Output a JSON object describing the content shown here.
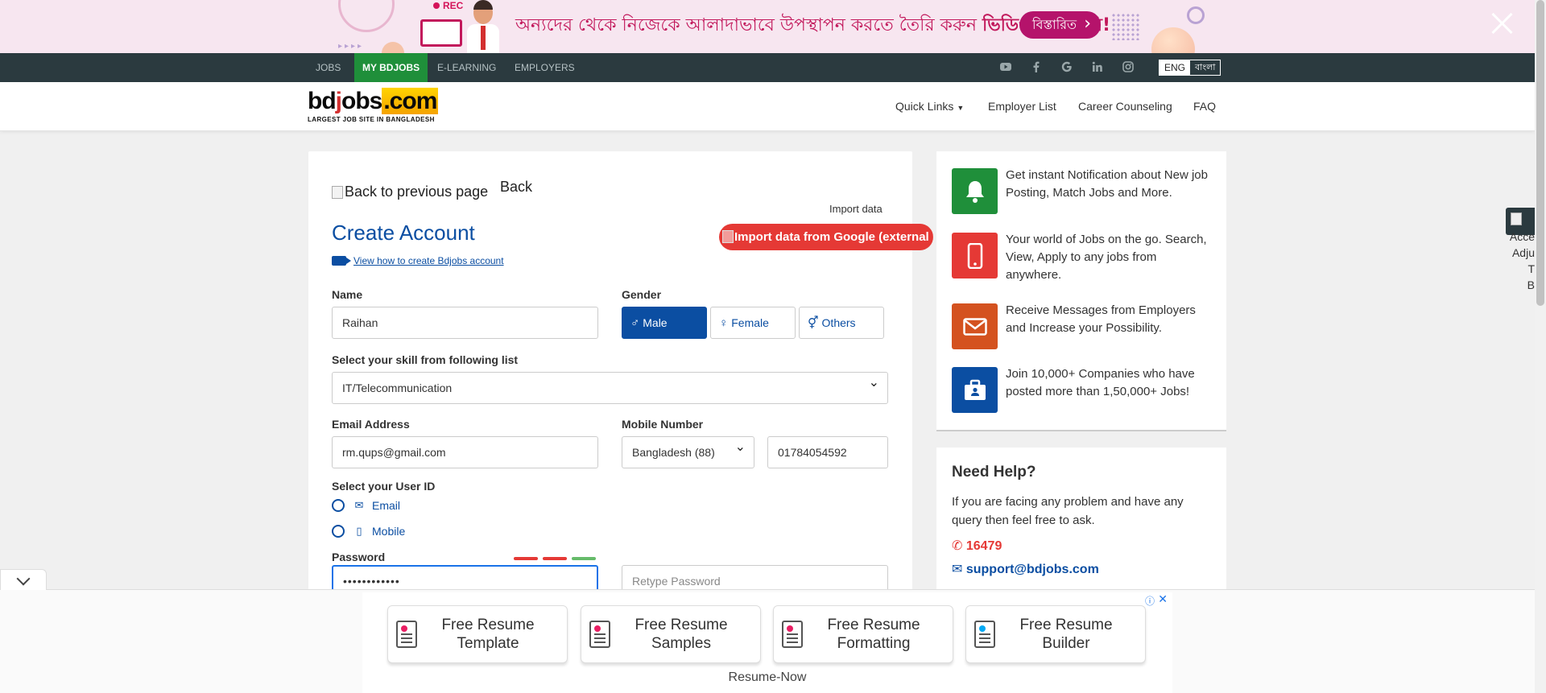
{
  "promo": {
    "rec": "REC",
    "headline_part1": "অন্যদের থেকে নিজেকে আলাদাভাবে উপস্থাপন করতে তৈরি করুন ",
    "headline_part2": "ভিডিও রিজিউমি!",
    "more": "বিস্তারিত"
  },
  "topnav": {
    "items": [
      "JOBS",
      "MY BDJOBS",
      "E-LEARNING",
      "EMPLOYERS"
    ],
    "active": "MY BDJOBS",
    "lang_eng": "ENG",
    "lang_bn": "বাংলা"
  },
  "header": {
    "logo_text": "bdjobs.com",
    "logo_tagline": "LARGEST JOB SITE IN BANGLADESH",
    "nav": [
      "Quick Links",
      "Employer List",
      "Career Counseling",
      "FAQ"
    ]
  },
  "form": {
    "back_img_alt": "Back to previous page",
    "back": "Back",
    "import_label": "Import data",
    "import_btn": "Import data from Google (external lin",
    "title": "Create Account",
    "howto_link": "View how to create Bdjobs account",
    "name_label": "Name",
    "name_value": "Raihan",
    "gender_label": "Gender",
    "gender": {
      "male": "Male",
      "female": "Female",
      "others": "Others",
      "selected": "Male"
    },
    "skill_label": "Select your skill from following list",
    "skill_value": "IT/Telecommunication",
    "email_label": "Email Address",
    "email_value": "rm.qups@gmail.com",
    "mobile_label": "Mobile Number",
    "country_value": "Bangladesh (88)",
    "mobile_value": "01784054592",
    "userid_label": "Select your User ID",
    "userid_email": "Email",
    "userid_mobile": "Mobile",
    "password_label": "Password",
    "password_value": "••••••••••••",
    "retype_placeholder": "Retype Password",
    "strength_colors": [
      "#e53935",
      "#e53935",
      "#66bb6a"
    ]
  },
  "features": [
    {
      "text": "Get instant Notification about New job Posting, Match Jobs and More.",
      "color": "#1f8f3a",
      "icon": "bell-icon"
    },
    {
      "text": "Your world of Jobs on the go. Search, View, Apply to any jobs from anywhere.",
      "color": "#e53935",
      "icon": "mobile-icon"
    },
    {
      "text": "Receive Messages from Employers and Increase your Possibility.",
      "color": "#d4521f",
      "icon": "envelope-icon"
    },
    {
      "text": "Join 10,000+ Companies who have posted more than 1,50,000+ Jobs!",
      "color": "#0b4ea2",
      "icon": "briefcase-icon"
    }
  ],
  "help": {
    "title": "Need Help?",
    "text": "If you are facing any problem and have any query then feel free to ask.",
    "phone": "16479",
    "email": "support@bdjobs.com"
  },
  "accessibility": {
    "text": "Acce\nAdju\nT\nB"
  },
  "ad": {
    "buttons": [
      "Free Resume Template",
      "Free Resume Samples",
      "Free Resume Formatting",
      "Free Resume Builder"
    ],
    "brand": "Resume-Now",
    "icon_colors": [
      "#e91e63",
      "#e91e63",
      "#e91e63",
      "#03a9f4"
    ]
  }
}
